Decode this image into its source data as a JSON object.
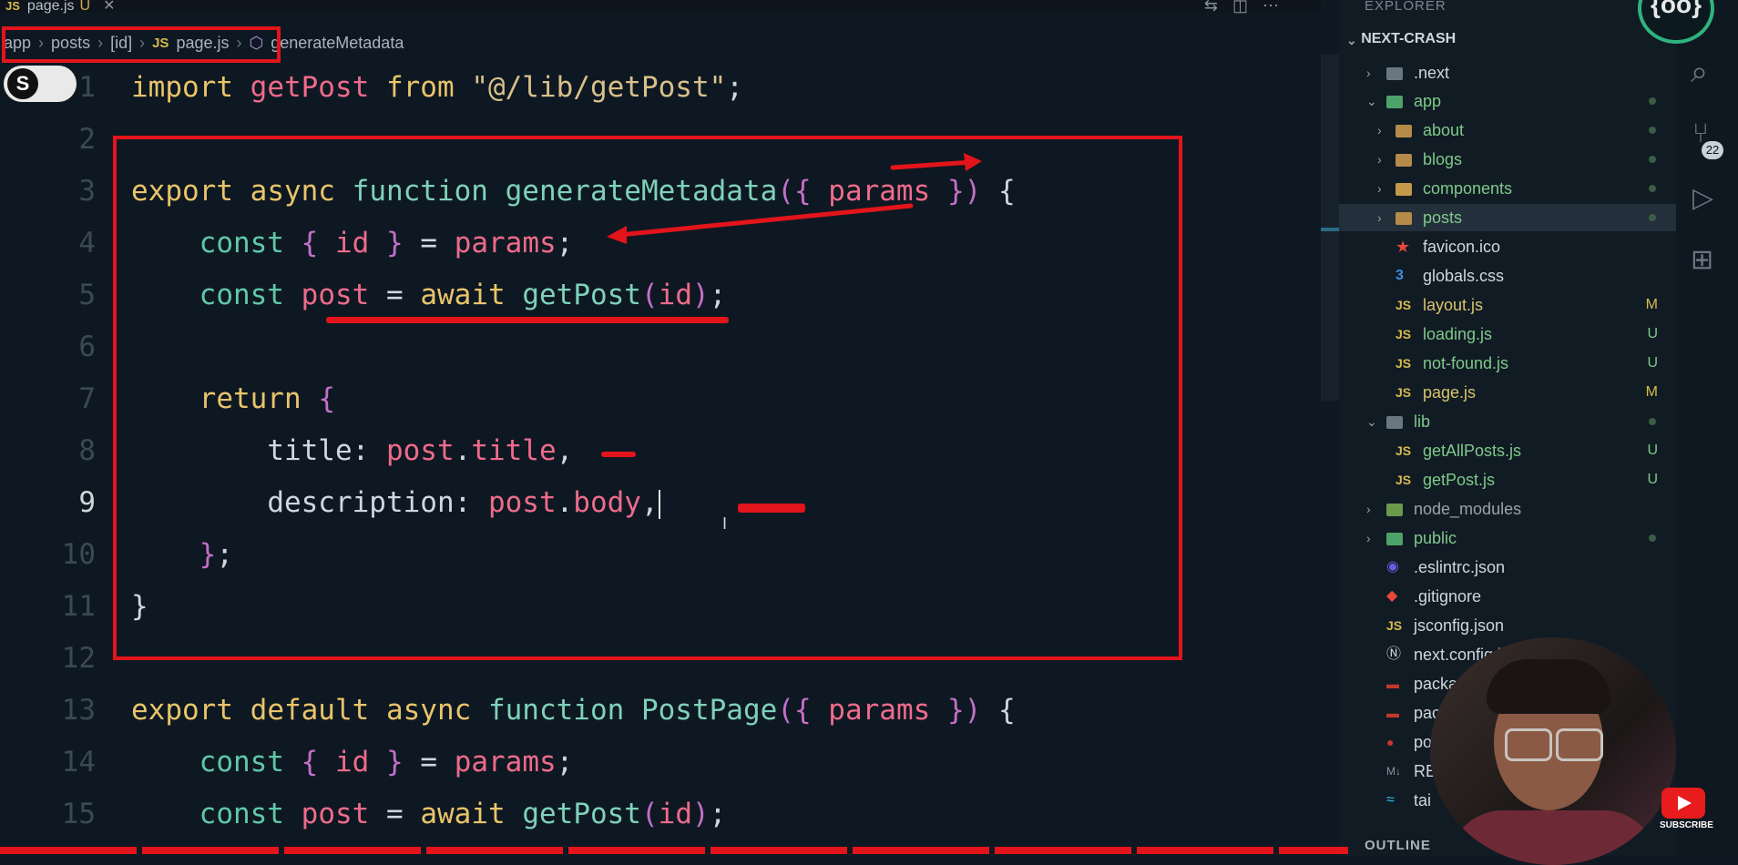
{
  "tab": {
    "js": "JS",
    "name": "page.js",
    "status": "U"
  },
  "breadcrumb": {
    "items": [
      "app",
      "posts",
      "[id]"
    ],
    "js": "JS",
    "file": "page.js",
    "symbol": "generateMetadata"
  },
  "toggle_label": "S",
  "code": {
    "line_numbers": [
      "1",
      "2",
      "3",
      "4",
      "5",
      "6",
      "7",
      "8",
      "9",
      "10",
      "11",
      "12",
      "13",
      "14",
      "15"
    ],
    "current_line": "9"
  },
  "explorer": {
    "title": "EXPLORER",
    "project": "NEXT-CRASH",
    "items": [
      {
        "name": ".next"
      },
      {
        "name": "app"
      },
      {
        "name": "about"
      },
      {
        "name": "blogs"
      },
      {
        "name": "components"
      },
      {
        "name": "posts"
      },
      {
        "name": "favicon.ico"
      },
      {
        "name": "globals.css"
      },
      {
        "name": "layout.js",
        "badge": "M"
      },
      {
        "name": "loading.js",
        "badge": "U"
      },
      {
        "name": "not-found.js",
        "badge": "U"
      },
      {
        "name": "page.js",
        "badge": "M"
      },
      {
        "name": "lib"
      },
      {
        "name": "getAllPosts.js",
        "badge": "U"
      },
      {
        "name": "getPost.js",
        "badge": "U"
      },
      {
        "name": "node_modules"
      },
      {
        "name": "public"
      },
      {
        "name": ".eslintrc.json"
      },
      {
        "name": ".gitignore"
      },
      {
        "name": "jsconfig.json"
      },
      {
        "name": "next.config.j"
      },
      {
        "name": "packag"
      },
      {
        "name": "pac"
      },
      {
        "name": "po"
      },
      {
        "name": "RE"
      },
      {
        "name": "tai"
      }
    ],
    "outline": "OUTLINE"
  },
  "activity": {
    "scm_badge": "22"
  },
  "logo": "{oo}",
  "youtube": {
    "label": "SUBSCRIBE"
  },
  "colors": {
    "highlight": "#e3141b",
    "background": "#0e1822",
    "sidebar": "#111b24"
  }
}
